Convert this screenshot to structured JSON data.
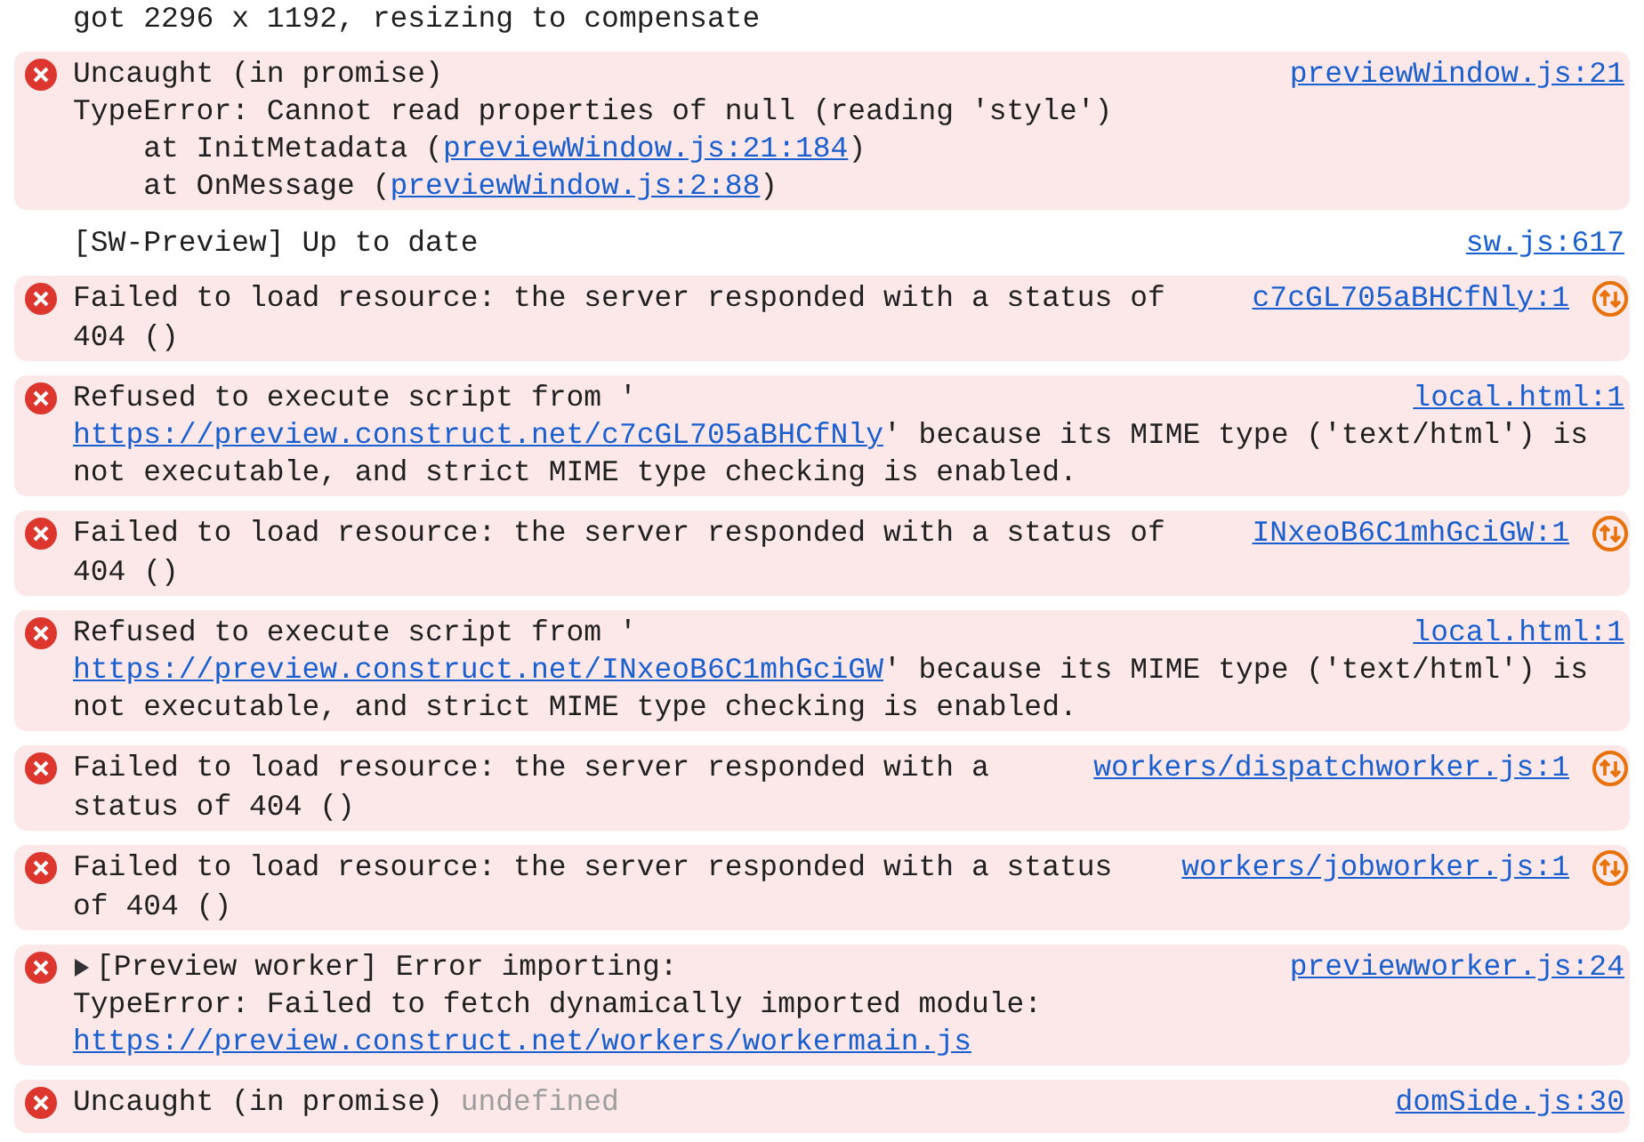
{
  "console": {
    "messages": [
      {
        "error": false,
        "lines": [
          [
            {
              "kind": "text",
              "text": "got 2296 x 1192, resizing to compensate"
            }
          ]
        ]
      },
      {
        "error": true,
        "source": "previewWindow.js:21",
        "network_issue": false,
        "lines": [
          [
            {
              "kind": "text",
              "text": "Uncaught (in promise)"
            }
          ],
          [
            {
              "kind": "text",
              "text": "TypeError: Cannot read properties of null (reading 'style')"
            }
          ],
          [
            {
              "kind": "text",
              "text": "    at InitMetadata ("
            },
            {
              "kind": "link",
              "text": "previewWindow.js:21:184"
            },
            {
              "kind": "text",
              "text": ")"
            }
          ],
          [
            {
              "kind": "text",
              "text": "    at OnMessage ("
            },
            {
              "kind": "link",
              "text": "previewWindow.js:2:88"
            },
            {
              "kind": "text",
              "text": ")"
            }
          ]
        ]
      },
      {
        "error": false,
        "source": "sw.js:617",
        "lines": [
          [
            {
              "kind": "text",
              "text": "[SW-Preview] Up to date"
            }
          ]
        ]
      },
      {
        "error": true,
        "source": "c7cGL705aBHCfNly:1",
        "network_issue": true,
        "lines": [
          [
            {
              "kind": "text",
              "text": "Failed to load resource: the server responded with a status of"
            }
          ],
          [
            {
              "kind": "text",
              "text": "404 ()"
            }
          ]
        ]
      },
      {
        "error": true,
        "source": "local.html:1",
        "network_issue": false,
        "lines": [
          [
            {
              "kind": "text",
              "text": "Refused to execute script from '"
            }
          ],
          [
            {
              "kind": "link",
              "text": "https://preview.construct.net/c7cGL705aBHCfNly"
            },
            {
              "kind": "text",
              "text": "' because its MIME type ('text/html') is"
            }
          ],
          [
            {
              "kind": "text",
              "text": "not executable, and strict MIME type checking is enabled."
            }
          ]
        ]
      },
      {
        "error": true,
        "source": "INxeoB6C1mhGciGW:1",
        "network_issue": true,
        "lines": [
          [
            {
              "kind": "text",
              "text": "Failed to load resource: the server responded with a status of"
            }
          ],
          [
            {
              "kind": "text",
              "text": "404 ()"
            }
          ]
        ]
      },
      {
        "error": true,
        "source": "local.html:1",
        "network_issue": false,
        "lines": [
          [
            {
              "kind": "text",
              "text": "Refused to execute script from '"
            }
          ],
          [
            {
              "kind": "link",
              "text": "https://preview.construct.net/INxeoB6C1mhGciGW"
            },
            {
              "kind": "text",
              "text": "' because its MIME type ('text/html') is"
            }
          ],
          [
            {
              "kind": "text",
              "text": "not executable, and strict MIME type checking is enabled."
            }
          ]
        ]
      },
      {
        "error": true,
        "source": "workers/dispatchworker.js:1",
        "network_issue": true,
        "lines": [
          [
            {
              "kind": "text",
              "text": "Failed to load resource: the server responded with a"
            }
          ],
          [
            {
              "kind": "text",
              "text": "status of 404 ()"
            }
          ]
        ]
      },
      {
        "error": true,
        "source": "workers/jobworker.js:1",
        "network_issue": true,
        "lines": [
          [
            {
              "kind": "text",
              "text": "Failed to load resource: the server responded with a status"
            }
          ],
          [
            {
              "kind": "text",
              "text": "of 404 ()"
            }
          ]
        ]
      },
      {
        "error": true,
        "source": "previewworker.js:24",
        "network_issue": false,
        "expanded": false,
        "lines": [
          [
            {
              "kind": "text",
              "text": "[Preview worker] Error importing:"
            }
          ],
          [
            {
              "kind": "text",
              "text": "TypeError: Failed to fetch dynamically imported module:"
            }
          ],
          [
            {
              "kind": "link",
              "text": "https://preview.construct.net/workers/workermain.js"
            }
          ]
        ]
      },
      {
        "error": true,
        "source": "domSide.js:30",
        "network_issue": false,
        "lines": [
          [
            {
              "kind": "text",
              "text": "Uncaught (in promise) "
            },
            {
              "kind": "muted",
              "text": "undefined"
            }
          ]
        ]
      }
    ]
  }
}
